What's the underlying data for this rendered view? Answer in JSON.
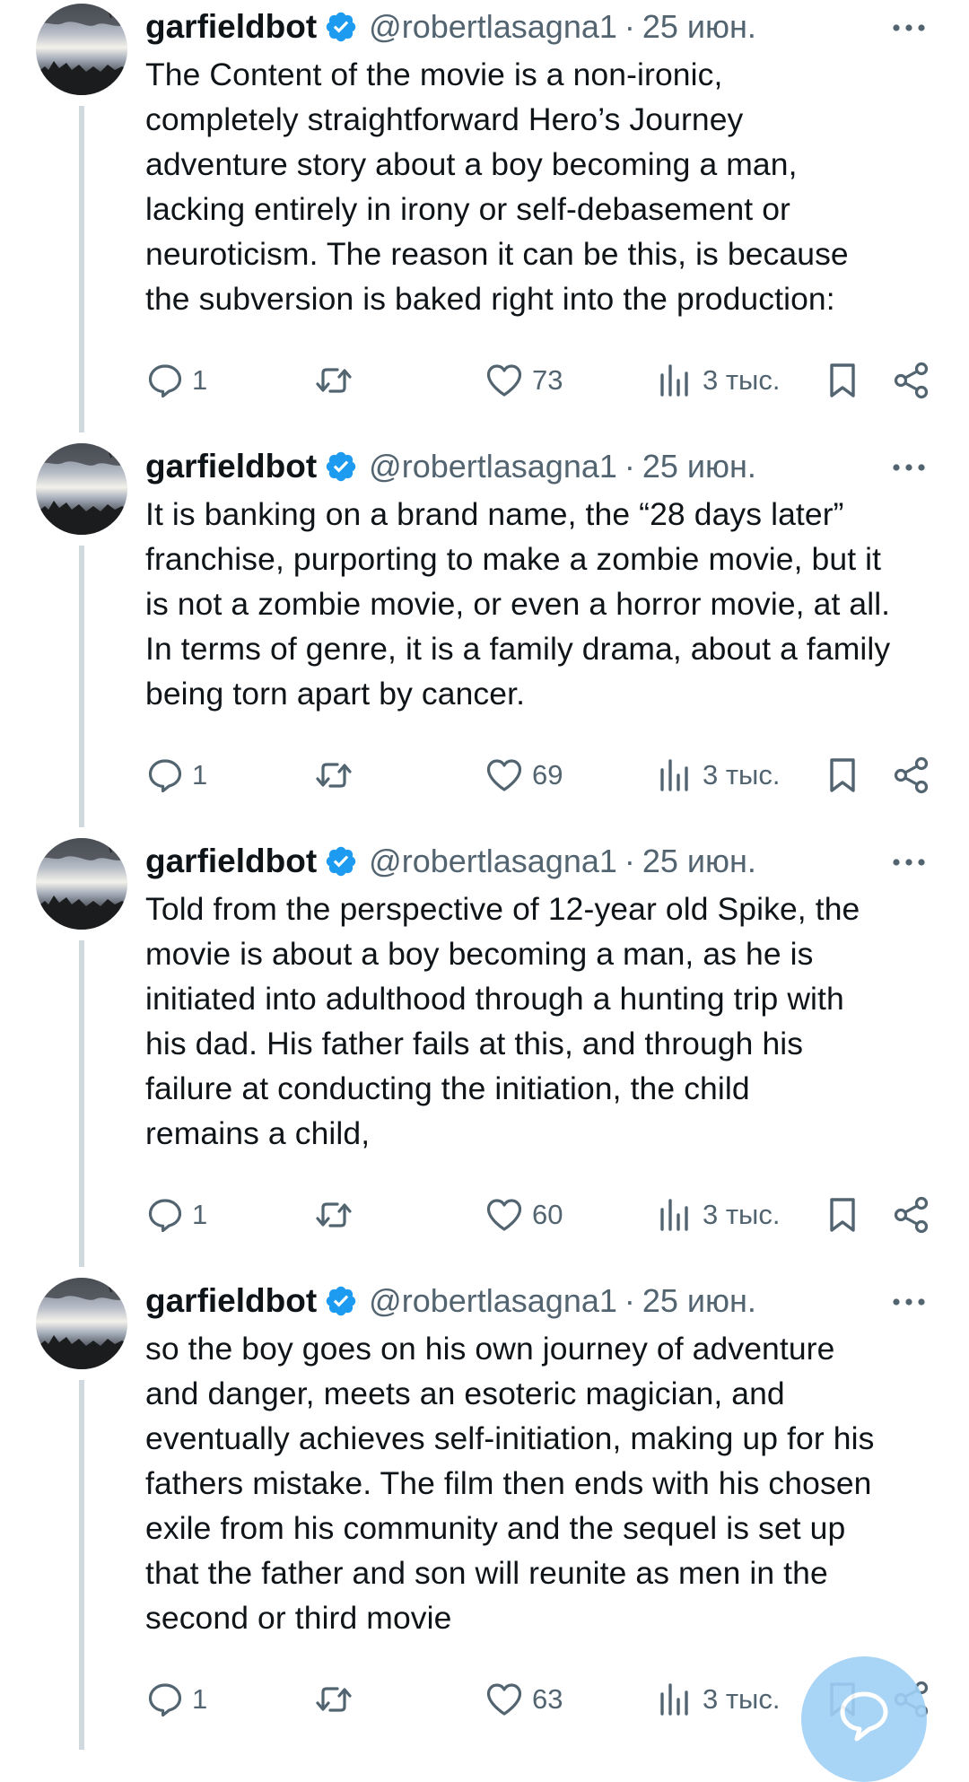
{
  "tweets": [
    {
      "author": "garfieldbot",
      "handle": "@robertlasagna1",
      "separator": "·",
      "date": "25 июн.",
      "lines": [
        "The Content of the movie is a non-ironic,",
        "completely straightforward Hero’s Journey",
        "adventure story about a boy becoming a man,",
        "lacking entirely in irony or self-debasement or",
        "neuroticism. The reason it can be this, is because",
        "the subversion is baked right into the production:"
      ],
      "replies": "1",
      "likes": "73",
      "views": "3 тыс."
    },
    {
      "author": "garfieldbot",
      "handle": "@robertlasagna1",
      "separator": "·",
      "date": "25 июн.",
      "lines": [
        "It is banking on a brand name, the “28 days later”",
        "franchise, purporting to make a zombie movie, but it",
        "is not a zombie movie, or even a horror movie, at all.",
        "In terms of genre, it is a family drama, about a family",
        "being torn apart by cancer."
      ],
      "replies": "1",
      "likes": "69",
      "views": "3 тыс."
    },
    {
      "author": "garfieldbot",
      "handle": "@robertlasagna1",
      "separator": "·",
      "date": "25 июн.",
      "lines": [
        "Told from the perspective of 12-year old Spike, the",
        "movie is about a boy becoming a man, as he is",
        "initiated into adulthood through a hunting trip with",
        "his dad. His father fails at this, and through his",
        "failure at conducting the initiation, the child",
        "remains a child,"
      ],
      "replies": "1",
      "likes": "60",
      "views": "3 тыс."
    },
    {
      "author": "garfieldbot",
      "handle": "@robertlasagna1",
      "separator": "·",
      "date": "25 июн.",
      "lines": [
        "so the boy goes on his own journey of adventure",
        "and danger, meets an esoteric magician, and",
        "eventually achieves self-initiation, making up for his",
        "fathers mistake. The film then ends with his chosen",
        "exile from his community and the sequel is set up",
        "that the father and son will reunite as men in the",
        "second or third movie"
      ],
      "replies": "1",
      "likes": "63",
      "views": "3 тыс."
    }
  ],
  "icons": {
    "verified": "verified-badge-icon",
    "more": "more-dots-icon",
    "reply": "reply-icon",
    "repost": "repost-icon",
    "like": "like-icon",
    "views": "views-icon",
    "bookmark": "bookmark-icon",
    "share": "share-icon",
    "compose": "compose-reply-icon"
  },
  "colors": {
    "text": "#0f1419",
    "secondary": "#536471",
    "verified": "#1d9bf0",
    "thread_line": "#cfd9de",
    "fab": "#9fd0f6"
  }
}
